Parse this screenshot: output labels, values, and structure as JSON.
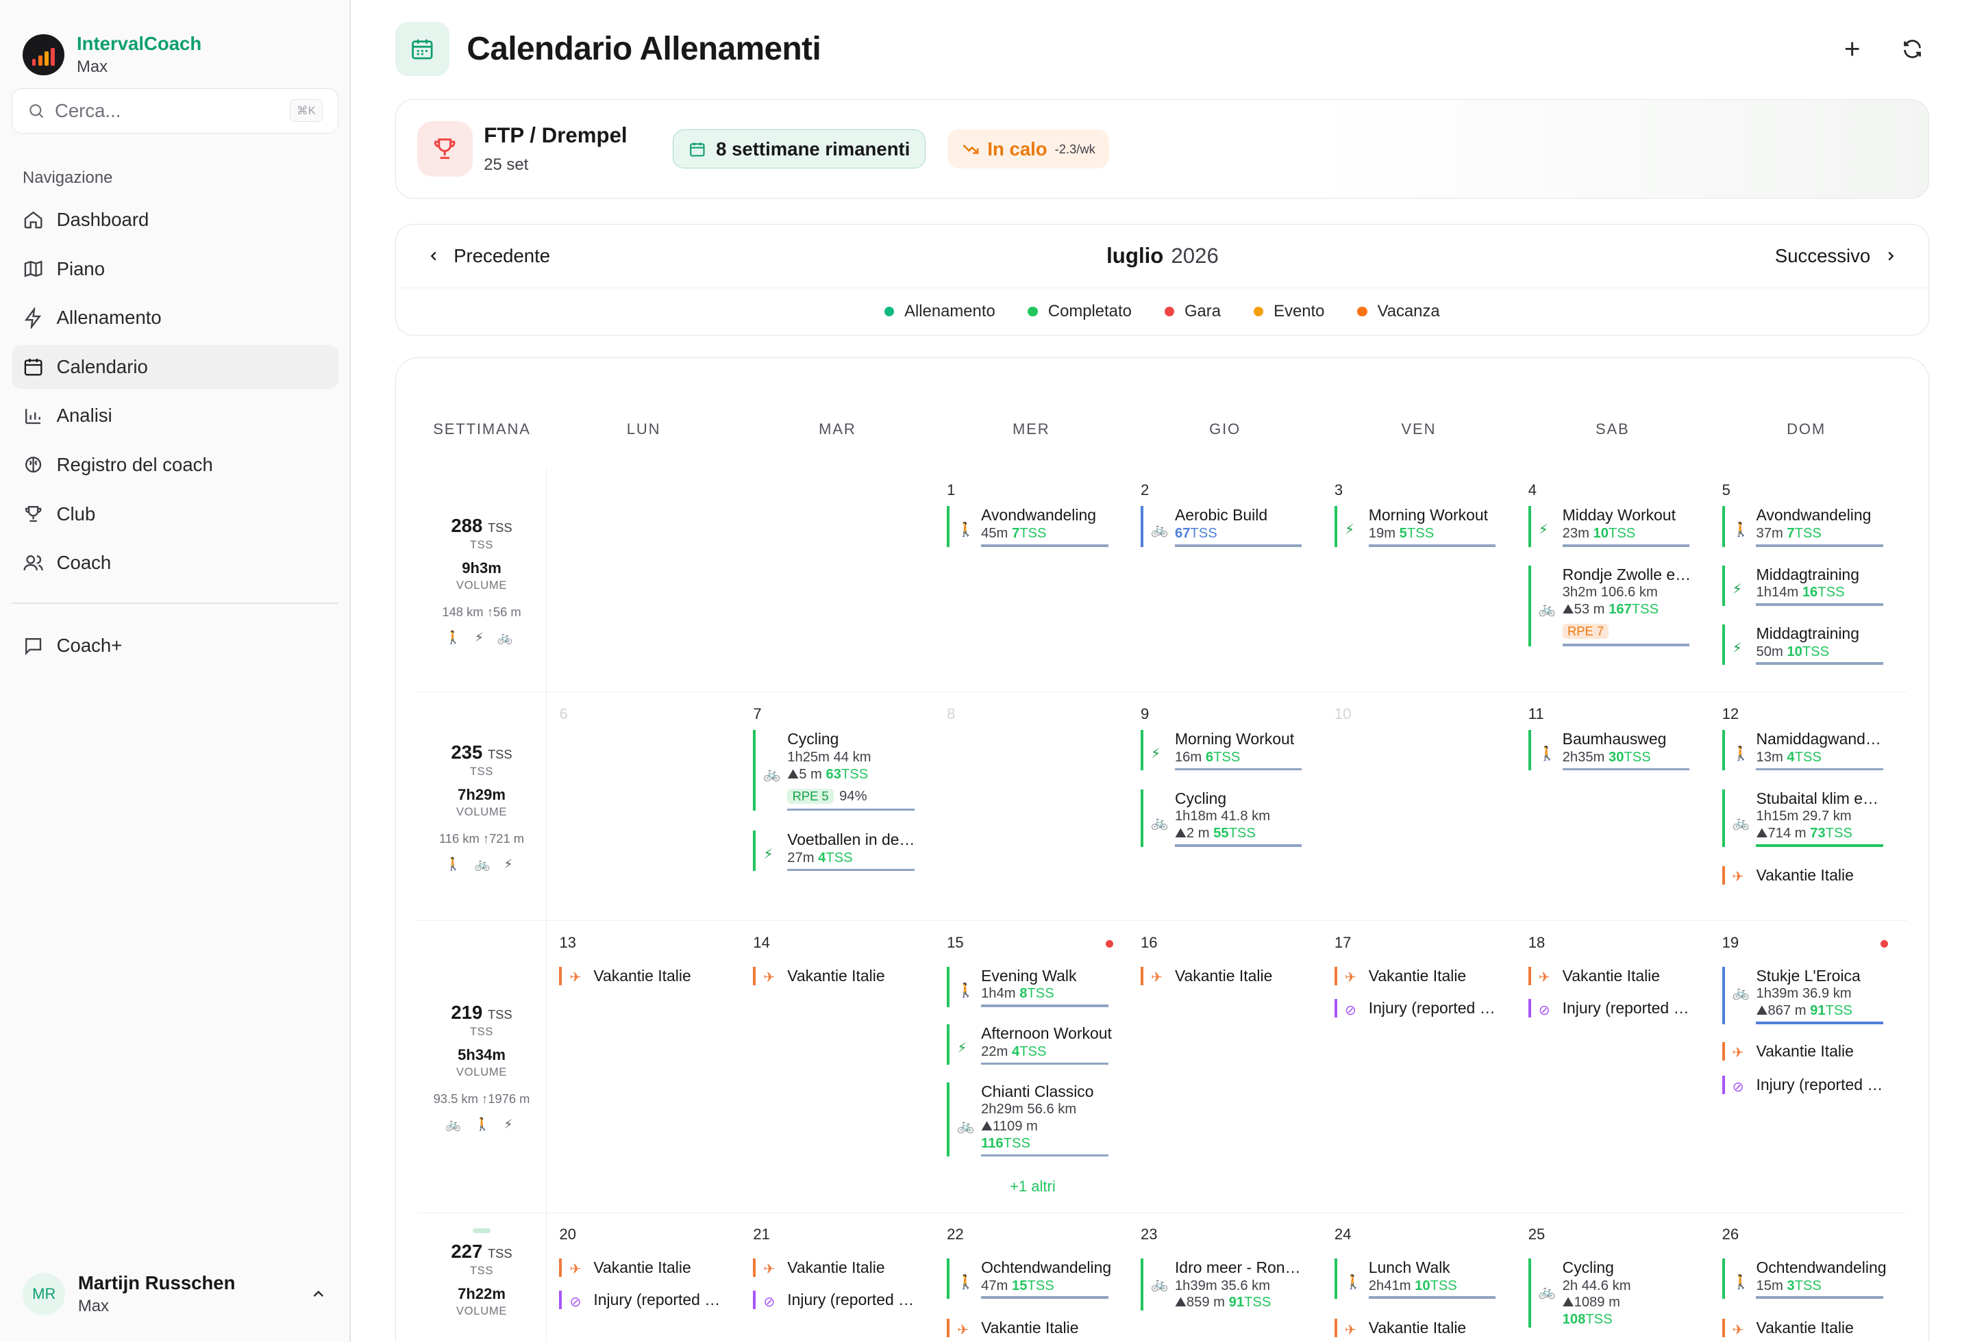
{
  "app": {
    "name": "IntervalCoach",
    "user_sub": "Max"
  },
  "search": {
    "placeholder": "Cerca...",
    "shortcut": "⌘K"
  },
  "nav": {
    "label": "Navigazione",
    "items": [
      "Dashboard",
      "Piano",
      "Allenamento",
      "Calendario",
      "Analisi",
      "Registro del coach",
      "Club",
      "Coach"
    ],
    "extra": "Coach+",
    "active": "Calendario"
  },
  "user": {
    "initials": "MR",
    "name": "Martijn Russchen",
    "sub": "Max"
  },
  "header": {
    "title": "Calendario Allenamenti",
    "add": "+",
    "refresh": "⟳"
  },
  "goal": {
    "name": "FTP / Drempel",
    "date": "25 set",
    "weeks": "8 settimane rimanenti",
    "trend": "In calo",
    "trend_rate": "-2.3/wk"
  },
  "calnav": {
    "prev": "Precedente",
    "next": "Successivo",
    "month": "luglio",
    "year": "2026"
  },
  "legend": [
    {
      "label": "Allenamento",
      "color": "#10b981"
    },
    {
      "label": "Completato",
      "color": "#22c55e"
    },
    {
      "label": "Gara",
      "color": "#ef4444"
    },
    {
      "label": "Evento",
      "color": "#f59e0b"
    },
    {
      "label": "Vacanza",
      "color": "#f97316"
    }
  ],
  "days": [
    "SETTIMANA",
    "LUN",
    "MAR",
    "MER",
    "GIO",
    "VEN",
    "SAB",
    "DOM"
  ],
  "weeks": [
    {
      "tss": "288",
      "tss_unit": "TSS",
      "tss_lbl": "TSS",
      "vol": "9h3m",
      "vol_lbl": "VOLUME",
      "km": "148 km",
      "elev": "↑56 m",
      "icons": "🚶 ⚡ 🚲"
    },
    {
      "tss": "235",
      "tss_unit": "TSS",
      "tss_lbl": "TSS",
      "vol": "7h29m",
      "vol_lbl": "VOLUME",
      "km": "116 km",
      "elev": "↑721 m",
      "icons": "🚶 🚲 ⚡"
    },
    {
      "tss": "219",
      "tss_unit": "TSS",
      "tss_lbl": "TSS",
      "vol": "5h34m",
      "vol_lbl": "VOLUME",
      "km": "93.5 km",
      "elev": "↑1976 m",
      "icons": "🚲 🚶 ⚡"
    },
    {
      "tss": "227",
      "tss_unit": "TSS",
      "tss_lbl": "TSS",
      "vol": "7h22m",
      "vol_lbl": "VOLUME",
      "km": "",
      "elev": "",
      "icons": ""
    }
  ],
  "dates": {
    "w1": [
      "",
      "",
      "1",
      "2",
      "3",
      "4",
      "5"
    ],
    "w2": [
      "6",
      "7",
      "8",
      "9",
      "10",
      "11",
      "12"
    ],
    "w3": [
      "13",
      "14",
      "15",
      "16",
      "17",
      "18",
      "19"
    ],
    "w4": [
      "20",
      "21",
      "22",
      "23",
      "24",
      "25",
      "26"
    ]
  },
  "events": {
    "e1": {
      "t": "Avondwandeling",
      "m": "45m",
      "tss": "7",
      "u": "TSS"
    },
    "e2": {
      "t": "Aerobic Build",
      "m": "",
      "tss": "67",
      "u": "TSS"
    },
    "e3": {
      "t": "Morning Workout",
      "m": "19m",
      "tss": "5",
      "u": "TSS"
    },
    "e4": {
      "t": "Midday Workout",
      "m": "23m",
      "tss": "10",
      "u": "TSS"
    },
    "e5": {
      "t": "Rondje Zwolle en omgeving",
      "m": "3h2m  106.6 km",
      "m2": "⛰53 m",
      "tss": "167",
      "u": "TSS",
      "rpe": "RPE 7"
    },
    "e6": {
      "t": "Avondwandeling",
      "m": "37m",
      "tss": "7",
      "u": "TSS"
    },
    "e7": {
      "t": "Middagtraining",
      "m": "1h14m",
      "tss": "16",
      "u": "TSS"
    },
    "e8": {
      "t": "Middagtraining",
      "m": "50m",
      "tss": "10",
      "u": "TSS"
    },
    "e9": {
      "t": "Cycling",
      "m": "1h25m  44 km",
      "m2": "⛰5 m",
      "tss": "63",
      "u": "TSS",
      "rpe": "RPE 5",
      "pct": "94%"
    },
    "e10": {
      "t": "Voetballen in de middag",
      "m": "27m",
      "tss": "4",
      "u": "TSS"
    },
    "e11": {
      "t": "Morning Workout",
      "m": "16m",
      "tss": "6",
      "u": "TSS"
    },
    "e12": {
      "t": "Cycling",
      "m": "1h18m  41.8 km",
      "m2": "⛰2 m",
      "tss": "55",
      "u": "TSS"
    },
    "e13": {
      "t": "Baumhausweg",
      "m": "2h35m",
      "tss": "30",
      "u": "TSS"
    },
    "e14": {
      "t": "Namiddagwandeling",
      "m": "13m",
      "tss": "4",
      "u": "TSS"
    },
    "e15": {
      "t": "Stubaital klim en afdaling",
      "m": "1h15m  29.7 km",
      "m2": "⛰714 m",
      "tss": "73",
      "u": "TSS"
    },
    "vac": "Vakantie Italie",
    "inj": "Injury (reported by athlete)",
    "e16": {
      "t": "Evening Walk",
      "m": "1h4m",
      "tss": "8",
      "u": "TSS"
    },
    "e17": {
      "t": "Afternoon Workout",
      "m": "22m",
      "tss": "4",
      "u": "TSS"
    },
    "e18": {
      "t": "Chianti Classico",
      "m": "2h29m  56.6 km",
      "m2": "⛰1109 m",
      "tss": "116",
      "u": "TSS"
    },
    "more": "+1 altri",
    "e19": {
      "t": "Stukje L'Eroica",
      "m": "1h39m  36.9 km",
      "m2": "⛰867 m",
      "tss": "91",
      "u": "TSS"
    },
    "e20": {
      "t": "Ochtendwandeling",
      "m": "47m",
      "tss": "15",
      "u": "TSS"
    },
    "e21": {
      "t": "Idro meer - Rondje",
      "m": "1h39m  35.6 km",
      "m2": "⛰859 m",
      "tss": "91",
      "u": "TSS"
    },
    "e22": {
      "t": "Lunch Walk",
      "m": "2h41m",
      "tss": "10",
      "u": "TSS"
    },
    "e23": {
      "t": "Cycling",
      "m": "2h  44.6 km",
      "m2": "⛰1089 m",
      "tss": "108",
      "u": "TSS"
    },
    "e24": {
      "t": "Ochtendwandeling",
      "m": "15m",
      "tss": "3",
      "u": "TSS"
    }
  }
}
